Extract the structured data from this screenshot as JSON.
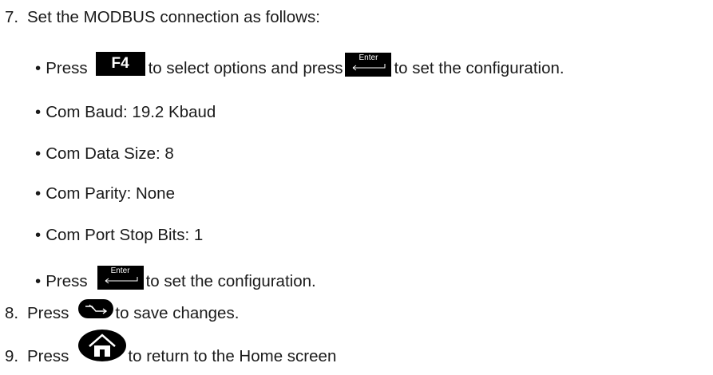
{
  "steps": [
    {
      "number": "7.",
      "text": "Set the MODBUS connection as follows:"
    },
    {
      "number": "8.",
      "before": "Press",
      "after": "to save changes.",
      "icon": "save-icon"
    },
    {
      "number": "9.",
      "before": "Press",
      "after": "to return to the Home screen",
      "icon": "home-icon"
    }
  ],
  "bullets": {
    "marker": "•",
    "press_line": {
      "before": "Press",
      "key_f4": "F4",
      "middle": "to select options and press",
      "key_enter": "Enter",
      "after": "to set the configuration."
    },
    "settings": [
      "Com Baud: 19.2 Kbaud",
      "Com Data Size: 8",
      "Com Parity: None",
      "Com Port Stop Bits: 1"
    ],
    "final_press": {
      "before": "Press",
      "key_enter": "Enter",
      "after": "to set the configuration."
    }
  },
  "colors": {
    "text": "#1a1a1a",
    "key_bg": "#000000",
    "key_text": "#ffffff"
  }
}
